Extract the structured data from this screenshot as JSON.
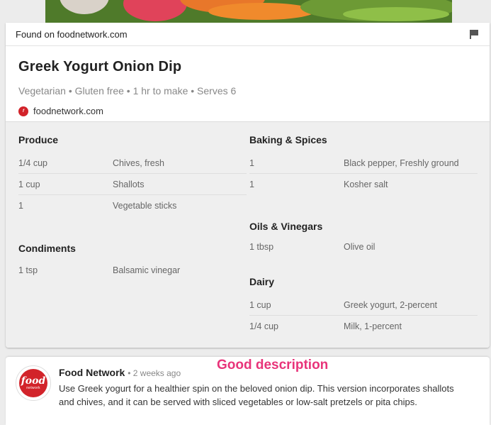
{
  "found": {
    "text": "Found on foodnetwork.com"
  },
  "recipe": {
    "title": "Greek Yogurt Onion Dip",
    "meta": "Vegetarian • Gluten free • 1 hr to make • Serves 6",
    "source": "foodnetwork.com"
  },
  "ingredients": {
    "left": [
      {
        "title": "Produce",
        "rows": [
          {
            "qty": "1/4 cup",
            "item": "Chives, fresh"
          },
          {
            "qty": "1 cup",
            "item": "Shallots"
          },
          {
            "qty": "1",
            "item": "Vegetable sticks"
          }
        ]
      },
      {
        "title": "Condiments",
        "rows": [
          {
            "qty": "1 tsp",
            "item": "Balsamic vinegar"
          }
        ]
      }
    ],
    "right": [
      {
        "title": "Baking & Spices",
        "rows": [
          {
            "qty": "1",
            "item": "Black pepper, Freshly ground"
          },
          {
            "qty": "1",
            "item": "Kosher salt"
          }
        ]
      },
      {
        "title": "Oils & Vinegars",
        "rows": [
          {
            "qty": "1 tbsp",
            "item": "Olive oil"
          }
        ]
      },
      {
        "title": "Dairy",
        "rows": [
          {
            "qty": "1 cup",
            "item": "Greek yogurt, 2-percent"
          },
          {
            "qty": "1/4 cup",
            "item": "Milk, 1-percent"
          }
        ]
      }
    ]
  },
  "post": {
    "author": "Food Network",
    "time": "• 2 weeks ago",
    "logo_line1": "food",
    "logo_line2": "network",
    "description": "Use Greek yogurt for a healthier spin on the beloved onion dip. This version incorporates shallots and chives, and it can be served with sliced vegetables or low-salt pretzels or pita chips."
  },
  "annotation": {
    "text": "Good description"
  },
  "colors": {
    "brand": "#d2232a",
    "annotation": "#e8347a"
  }
}
